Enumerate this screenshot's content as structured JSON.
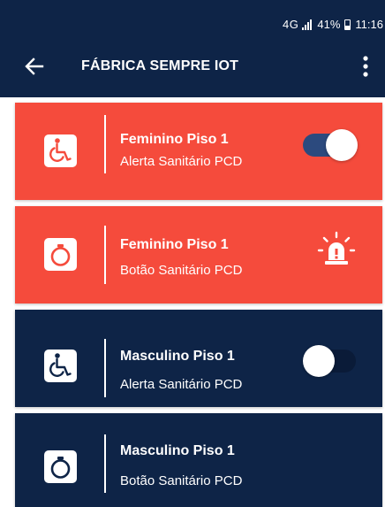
{
  "status_bar": {
    "network": "4G",
    "battery": "41%",
    "time": "11:16"
  },
  "app_bar": {
    "title": "FÁBRICA SEMPRE IOT"
  },
  "cards": [
    {
      "name": "Feminino Piso 1",
      "subtitle": "Alerta Sanitário PCD",
      "icon": "wheelchair-icon",
      "control": "toggle",
      "toggle_on": true
    },
    {
      "name": "Feminino Piso 1",
      "subtitle": "Botão Sanitário PCD",
      "icon": "ring-button-icon",
      "control": "alarm-light-icon"
    },
    {
      "name": "Masculino Piso 1",
      "subtitle": "Alerta Sanitário PCD",
      "icon": "wheelchair-icon",
      "control": "toggle",
      "toggle_on": false
    },
    {
      "name": "Masculino Piso 1",
      "subtitle": "Botão Sanitário PCD",
      "icon": "ring-button-icon"
    }
  ],
  "colors": {
    "navy": "#0e2447",
    "alert_red": "#f54b3c",
    "toggle_track_on": "#2c4a7e",
    "toggle_track_off": "#0a1b38"
  }
}
